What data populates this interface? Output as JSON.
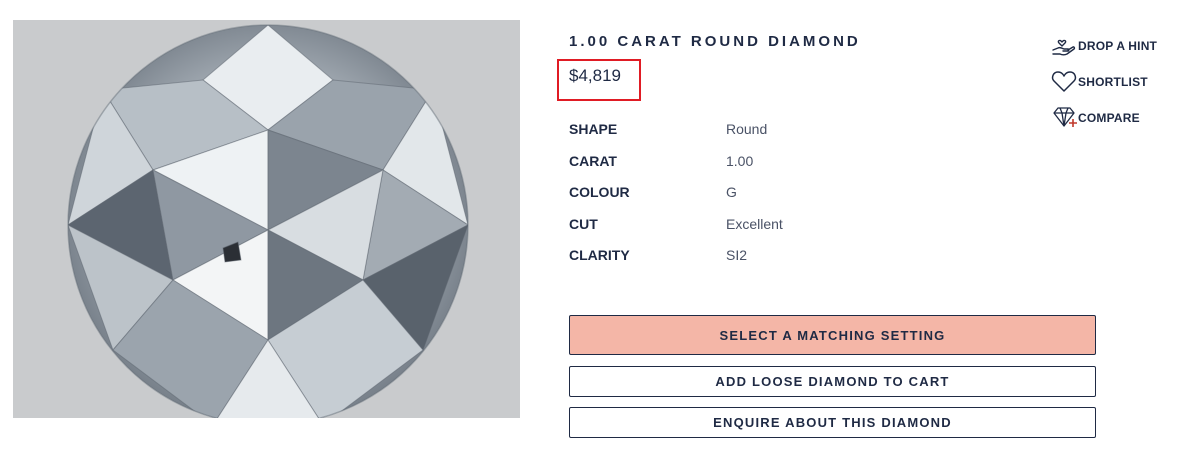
{
  "product": {
    "title": "1.00 CARAT ROUND DIAMOND",
    "price": "$4,819"
  },
  "specs": [
    {
      "label": "SHAPE",
      "value": "Round"
    },
    {
      "label": "CARAT",
      "value": "1.00"
    },
    {
      "label": "COLOUR",
      "value": "G"
    },
    {
      "label": "CUT",
      "value": "Excellent"
    },
    {
      "label": "CLARITY",
      "value": "SI2"
    }
  ],
  "actions": {
    "hint": {
      "label": "DROP A HINT",
      "icon": "hand-heart-icon"
    },
    "shortlist": {
      "label": "SHORTLIST",
      "icon": "heart-icon"
    },
    "compare": {
      "label": "COMPARE",
      "icon": "diamond-plus-icon"
    }
  },
  "buttons": {
    "select_setting": "SELECT A MATCHING SETTING",
    "add_to_cart": "ADD LOOSE DIAMOND TO CART",
    "enquire": "ENQUIRE ABOUT THIS DIAMOND"
  },
  "colors": {
    "primary_button": "#f4b6a7",
    "text": "#1f2a44",
    "highlight": "#e01b24"
  }
}
